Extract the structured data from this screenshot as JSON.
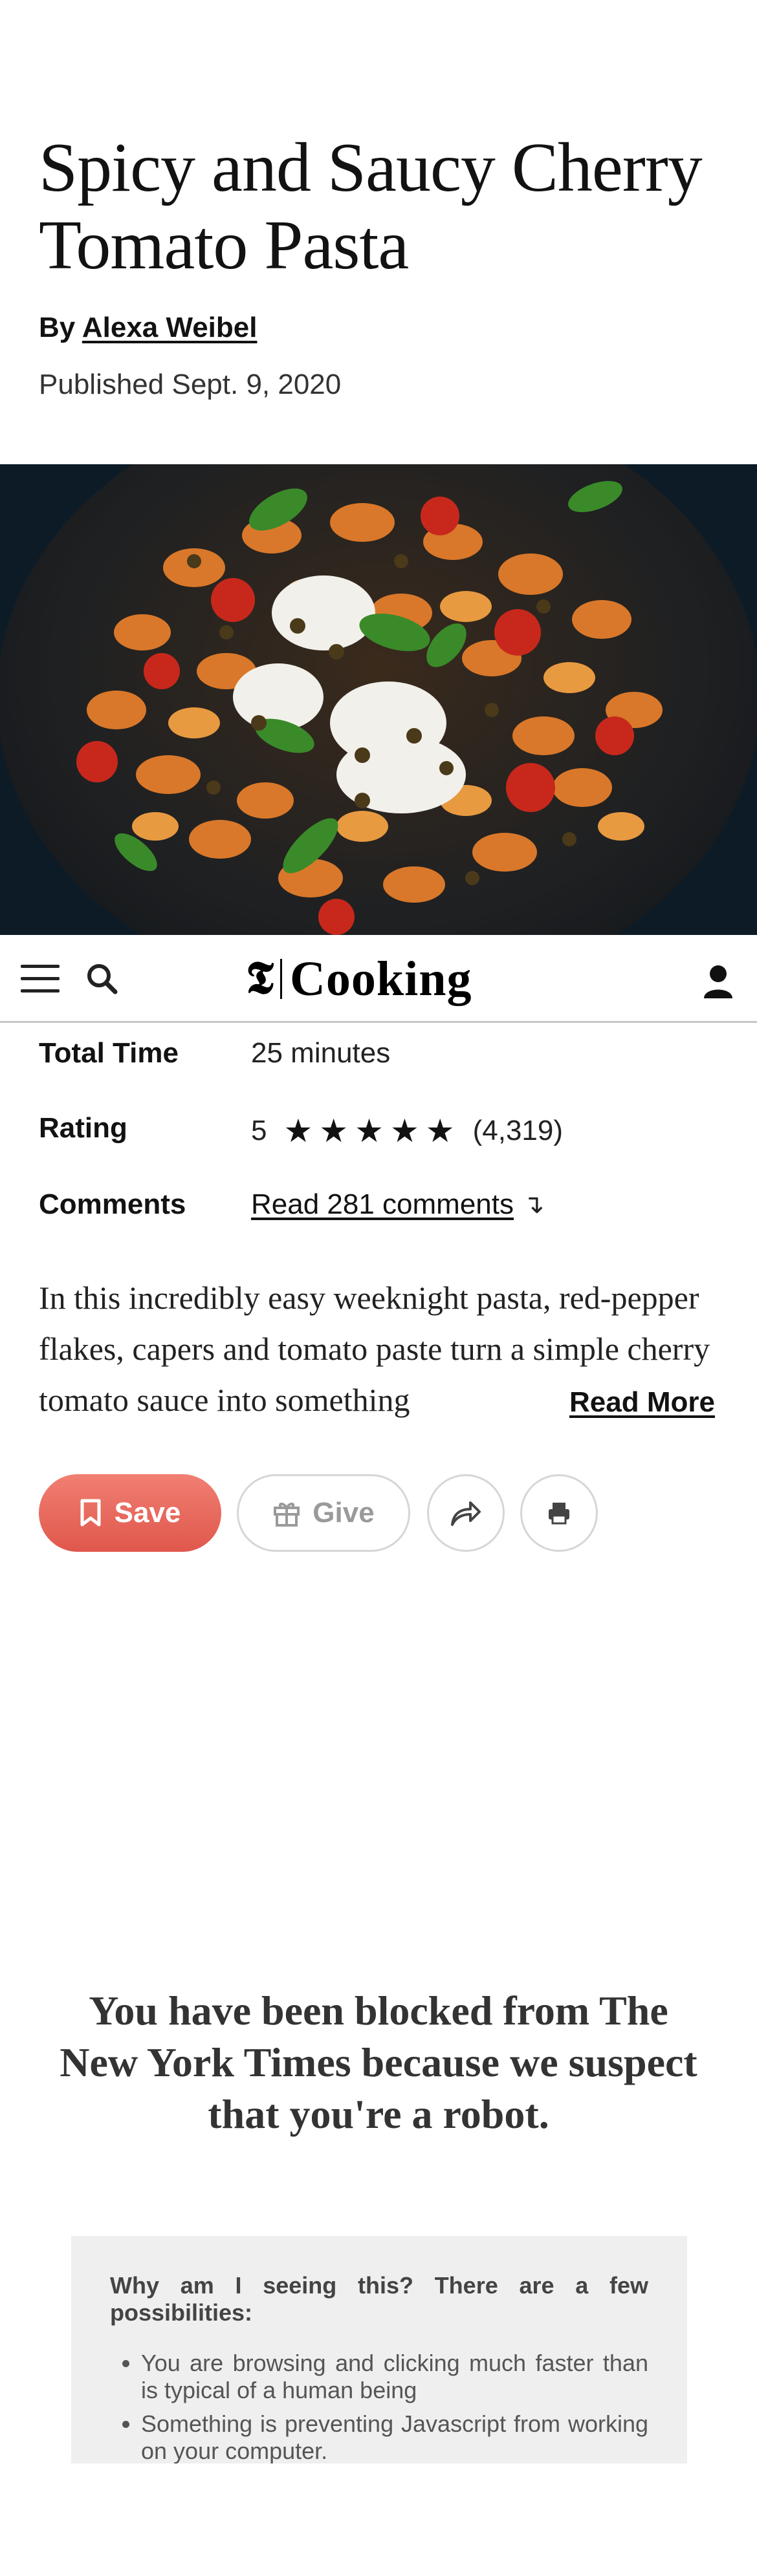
{
  "recipe": {
    "title": "Spicy and Saucy Cherry Tomato Pasta",
    "byline_prefix": "By",
    "author": "Alexa Weibel",
    "published": "Published Sept. 9, 2020"
  },
  "nav": {
    "logo_glyph": "𝕿",
    "logo_text": "Cooking",
    "icons": [
      "hamburger-menu-icon",
      "search-icon",
      "nyt-t-logo",
      "user-icon"
    ]
  },
  "meta": {
    "total_time_label": "Total Time",
    "total_time_value": "25 minutes",
    "rating_label": "Rating",
    "rating_value": "5",
    "rating_stars": "★★★★★",
    "rating_count": "(4,319)",
    "comments_label": "Comments",
    "comments_link": "Read 281 comments",
    "comments_arrow": "↴"
  },
  "description": {
    "text": "In this incredibly easy weeknight pasta, red-pepper flakes, capers and tomato paste turn a simple cherry tomato sauce into something",
    "read_more": "Read More"
  },
  "actions": {
    "save_label": "Save",
    "give_label": "Give",
    "save_color": "#e0574c",
    "icons": [
      "bookmark-icon",
      "gift-icon",
      "share-icon",
      "print-icon"
    ]
  },
  "blocked": {
    "heading": "You have been blocked from The New York Times because we suspect that you're a robot.",
    "why_title": "Why am I seeing this? There are a few possibilities:",
    "reasons": [
      "You are browsing and clicking much faster than is typical of a human being",
      "Something is preventing Javascript from working on your computer."
    ]
  }
}
